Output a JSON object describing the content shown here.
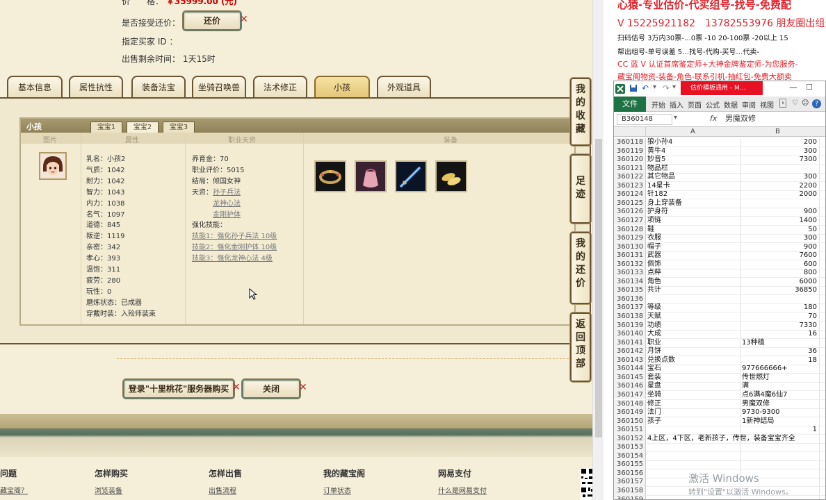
{
  "game": {
    "price_label": "价　　格：",
    "price_value": "￥35999.00 (元)",
    "accept_offer_label": "是否接受还价：",
    "offer_button": "还价",
    "buyer_id_label": "指定买家 ID ：",
    "remaining_label": "出售剩余时间：",
    "remaining_value": "1天15时",
    "tabs": [
      "基本信息",
      "属性抗性",
      "装备法宝",
      "坐骑召唤兽",
      "法术修正",
      "小孩",
      "外观道具"
    ],
    "sub_title": "小孩",
    "sub_tabs": [
      "宝宝1",
      "宝宝2",
      "宝宝3"
    ],
    "columns": [
      "图片",
      "属性",
      "职业天资",
      "装备"
    ],
    "attrs": [
      "乳名：小孩2",
      "气质：1042",
      "耐力：1042",
      "智力：1043",
      "内力：1038",
      "名气：1097",
      "道德：845",
      "叛逆：1119",
      "亲密：342",
      "孝心：393",
      "温饱：311",
      "疲劳：280",
      "玩性：0",
      "磨炼状态：已成器",
      "穿戴时装：入殓师装束"
    ],
    "talent": {
      "raise": "养育金：70",
      "rating": "职业评价：5015",
      "ending": "结局：倾国女神",
      "gift_label": "天资：",
      "gift1": "孙子兵法",
      "gift2": "龙神心法",
      "gift3": "金刚护体",
      "skill_label": "强化技能：",
      "skill1": "技能1：强化孙子兵法 10级",
      "skill2": "技能2：强化金刚护体 10级",
      "skill3": "技能3：强化龙神心法 4级"
    },
    "side_tabs": [
      "我的收藏",
      "足迹",
      "我的还价",
      "返回顶部"
    ],
    "login_button": "登录\"十里桃花\"服务器购买",
    "close_button": "关闭",
    "footer_heads": [
      "问题",
      "怎样购买",
      "怎样出售",
      "我的藏宝阁",
      "网易支付"
    ],
    "footer_links": [
      "藏宝阁？",
      "浏览装备",
      "出售流程",
      "订单状态",
      "什么是网易支付"
    ]
  },
  "promo": {
    "line1": "心猿-专业估价-代买组号-找号-免费配",
    "line2": "V 15225921182　13782553976 朋友圈出组号",
    "line3": "扫码估号 3万内30票-…0票 -10 20-100票 -20以上 15",
    "line4": "帮出组号-单号误差 5…找号-代购-买号…代卖-",
    "line5": "CC 蓝 V 认证首席鉴定师+大神金牌鉴定师-为您服务-",
    "line6": "藏宝阁物资-装备-角色-联系引机-抽红包-免费大额卖"
  },
  "excel": {
    "title_badge": "估价模板通用 - M…",
    "tabs": [
      "文件",
      "开始",
      "插入",
      "页面",
      "公式",
      "数据",
      "审阅",
      "视图"
    ],
    "name_box": "B360148",
    "fx": "fx",
    "formula_value": "男魔双修",
    "col_a": "A",
    "col_b": "B",
    "rows": [
      [
        "360118",
        "狼小孙4",
        "200"
      ],
      [
        "360119",
        "黄牛4",
        "300"
      ],
      [
        "360120",
        "妙音5",
        "7300"
      ],
      [
        "360121",
        "物品栏",
        ""
      ],
      [
        "360122",
        "其它物品",
        "300"
      ],
      [
        "360123",
        "14星卡",
        "2200"
      ],
      [
        "360124",
        "针182",
        "2000"
      ],
      [
        "360125",
        "身上穿装备",
        ""
      ],
      [
        "360126",
        "护身符",
        "900"
      ],
      [
        "360127",
        "项链",
        "1400"
      ],
      [
        "360128",
        "鞋",
        "50"
      ],
      [
        "360129",
        "衣服",
        "300"
      ],
      [
        "360130",
        "帽子",
        "900"
      ],
      [
        "360131",
        "武器",
        "7600"
      ],
      [
        "360132",
        "佩饰",
        "600"
      ],
      [
        "360133",
        "点粹",
        "800"
      ],
      [
        "360134",
        "角色",
        "6000"
      ],
      [
        "360135",
        "共计",
        "36850"
      ],
      [
        "360136",
        "",
        ""
      ],
      [
        "360137",
        "等级",
        "180"
      ],
      [
        "360138",
        "天赋",
        "70"
      ],
      [
        "360139",
        "功绩",
        "7330"
      ],
      [
        "360140",
        "大成",
        "16"
      ],
      [
        "360141",
        "职业",
        "13种植"
      ],
      [
        "360142",
        "月饼",
        "36"
      ],
      [
        "360143",
        "兑换点数",
        "18"
      ],
      [
        "360144",
        "宝石",
        "977666666+"
      ],
      [
        "360145",
        "套装",
        "传世燃灯"
      ],
      [
        "360146",
        "星盘",
        "满"
      ],
      [
        "360147",
        "坐骑",
        "点6满4魔6仙7"
      ],
      [
        "360148",
        "修正",
        "男魔双修"
      ],
      [
        "360149",
        "法门",
        "9730-9300"
      ],
      [
        "360150",
        "孩子",
        "1新神结局"
      ],
      [
        "360151",
        "",
        "1"
      ],
      [
        "360152",
        "4上区，4下区，老新孩子，传世，装备宝宝齐全",
        ""
      ],
      [
        "360153",
        "",
        ""
      ],
      [
        "360154",
        "",
        ""
      ],
      [
        "360155",
        "",
        ""
      ],
      [
        "360156",
        "",
        ""
      ],
      [
        "360157",
        "",
        ""
      ],
      [
        "360158",
        "",
        ""
      ],
      [
        "360159",
        "",
        ""
      ]
    ]
  },
  "windows": {
    "activate": "激活 Windows",
    "activate_hint": "转到\"设置\"以激活 Windows。"
  }
}
